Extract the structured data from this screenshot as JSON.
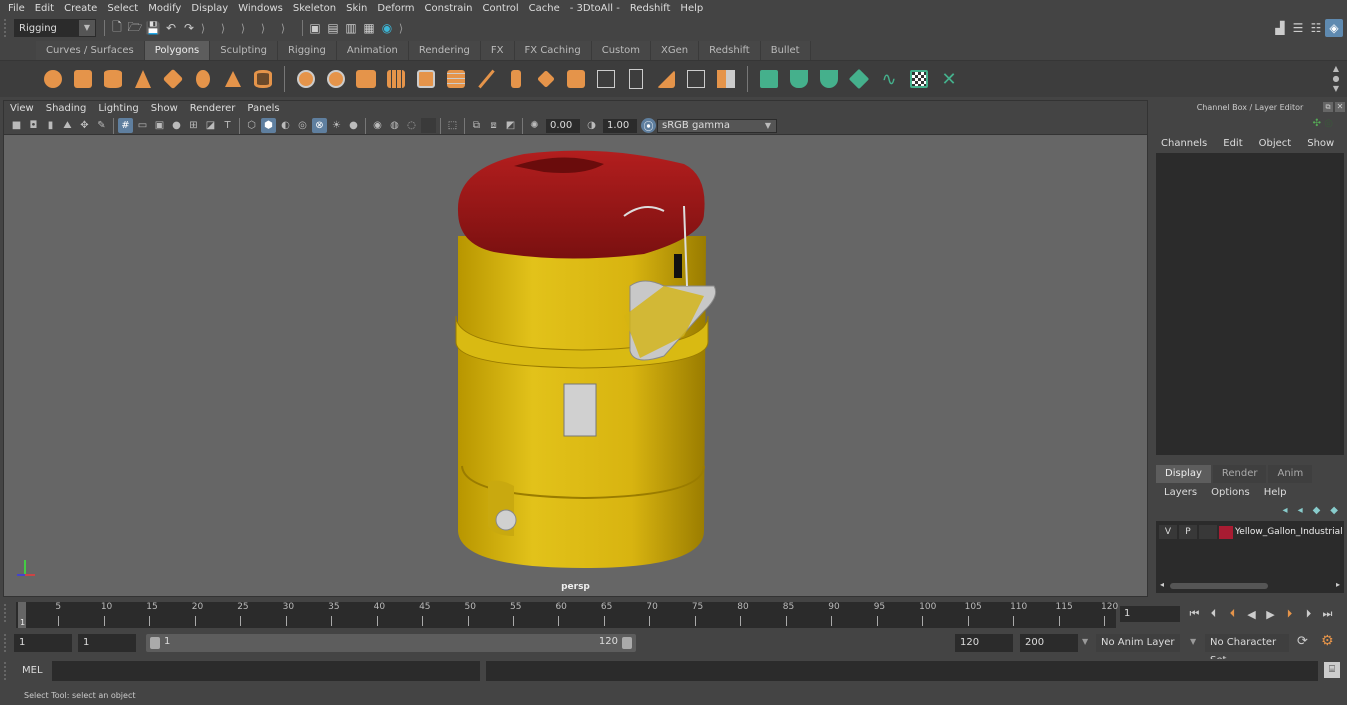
{
  "menubar": {
    "items": [
      "File",
      "Edit",
      "Create",
      "Select",
      "Modify",
      "Display",
      "Windows",
      "Skeleton",
      "Skin",
      "Deform",
      "Constrain",
      "Control",
      "Cache",
      "- 3DtoAll -",
      "Redshift",
      "Help"
    ]
  },
  "statusline": {
    "mode_selector": "Rigging",
    "icons": [
      "new-scene-icon",
      "open-scene-icon",
      "save-scene-icon",
      "undo-icon",
      "redo-icon"
    ],
    "render_icons": [
      "render-frame-icon",
      "render-sequence-icon",
      "ipr-render-icon",
      "render-settings-icon",
      "hypershade-icon"
    ],
    "right_icons": [
      "modeling-toolkit-icon",
      "attribute-editor-icon",
      "tool-settings-icon",
      "channel-box-icon"
    ]
  },
  "shelf": {
    "tabs": [
      "Curves / Surfaces",
      "Polygons",
      "Sculpting",
      "Rigging",
      "Animation",
      "Rendering",
      "FX",
      "FX Caching",
      "Custom",
      "XGen",
      "Redshift",
      "Bullet"
    ],
    "active_tab": "Polygons",
    "polygon_icons": [
      "poly-sphere-icon",
      "poly-cube-icon",
      "poly-cylinder-icon",
      "poly-cone-icon",
      "poly-plane-icon",
      "poly-torus-icon",
      "poly-pyramid-icon",
      "poly-pipe-icon"
    ],
    "edit_icons": [
      "combine-icon",
      "separate-icon",
      "mirror-icon",
      "smooth-icon",
      "extrude-icon",
      "bevel-icon",
      "bridge-icon",
      "insert-edge-loop-icon",
      "multi-cut-icon",
      "target-weld-icon",
      "quad-draw-icon",
      "append-polygon-icon",
      "fill-hole-icon",
      "merge-icon",
      "reduce-icon",
      "triangulate-icon"
    ],
    "uv_icons": [
      "planar-map-icon",
      "cylindrical-map-icon",
      "spherical-map-icon",
      "automatic-map-icon",
      "contour-stretch-icon",
      "uv-editor-icon",
      "uv-unfold-icon"
    ]
  },
  "viewport": {
    "menu": [
      "View",
      "Shading",
      "Lighting",
      "Show",
      "Renderer",
      "Panels"
    ],
    "exposure": "0.00",
    "gamma": "1.00",
    "color_space": "sRGB gamma",
    "camera_label": "persp"
  },
  "channel_box": {
    "title": "Channel Box / Layer Editor",
    "menu": [
      "Channels",
      "Edit",
      "Object",
      "Show"
    ]
  },
  "layer_editor": {
    "tabs": [
      "Display",
      "Render",
      "Anim"
    ],
    "active_tab": "Display",
    "menu": [
      "Layers",
      "Options",
      "Help"
    ],
    "layers": [
      {
        "visible": "V",
        "playback": "P",
        "color": "#a81c32",
        "name": "Yellow_Gallon_Industrial"
      }
    ]
  },
  "timeline": {
    "ticks": [
      5,
      10,
      15,
      20,
      25,
      30,
      35,
      40,
      45,
      50,
      55,
      60,
      65,
      70,
      75,
      80,
      85,
      90,
      95,
      100,
      105,
      110,
      115,
      120
    ],
    "start_marker": "1",
    "current_frame": "1",
    "playback_buttons": [
      "go-to-start-icon",
      "step-back-icon",
      "step-back-key-icon",
      "play-backward-icon",
      "play-forward-icon",
      "step-forward-key-icon",
      "step-forward-icon",
      "go-to-end-icon"
    ]
  },
  "range": {
    "start_time": "1",
    "playback_start": "1",
    "range_start_label": "1",
    "range_end_label": "120",
    "playback_end": "120",
    "end_time": "200",
    "anim_layer": "No Anim Layer",
    "character_set": "No Character Set"
  },
  "command_line": {
    "label": "MEL",
    "value": ""
  },
  "help_line": "Select Tool: select an object"
}
